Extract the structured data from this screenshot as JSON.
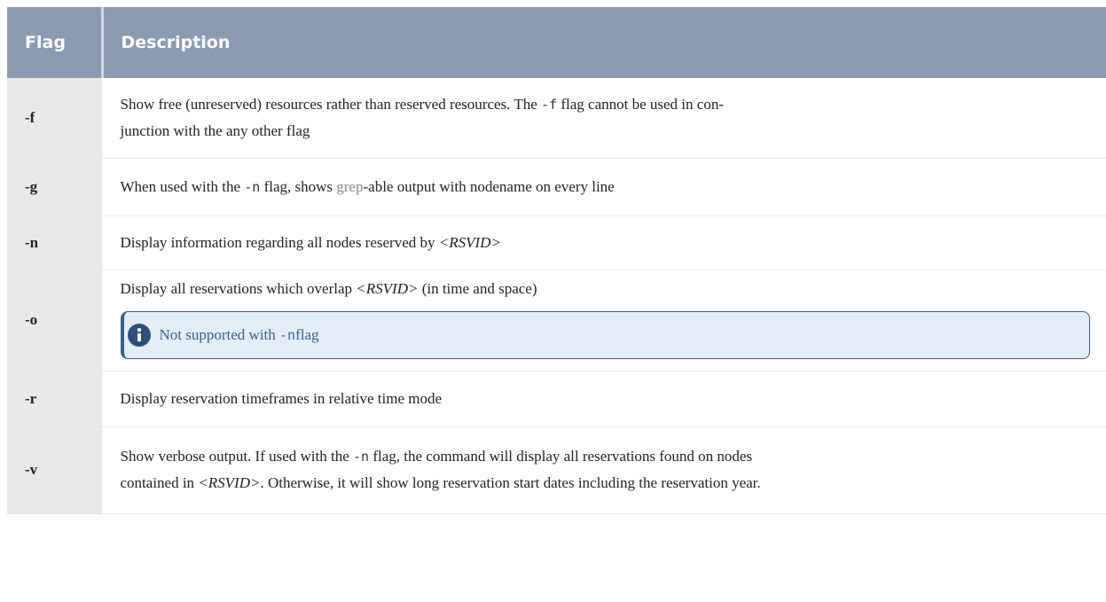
{
  "header": {
    "flag": "Flag",
    "description": "Description"
  },
  "rows": [
    {
      "flag": "-f",
      "desc_a": "Show free (unreserved) resources rather than reserved resources. The ",
      "desc_code": "-f",
      "desc_b": " flag cannot be used in con-",
      "desc_line2": "junction with the any other flag"
    },
    {
      "flag": "-g",
      "desc_a": "When used with the ",
      "desc_code": "-n",
      "desc_b": " flag, shows ",
      "desc_grep": "grep",
      "desc_c": "-able output with nodename on every line"
    },
    {
      "flag": "-n",
      "desc_a": "Display information regarding all nodes reserved by ",
      "desc_var": "<RSVID>"
    },
    {
      "flag": "-o",
      "desc_a": "Display all reservations which overlap ",
      "desc_var": "<RSVID>",
      "desc_b": " (in time and space)",
      "note_a": "Not supported with ",
      "note_code": "-n",
      "note_b": " flag"
    },
    {
      "flag": "-r",
      "desc_a": "Display reservation timeframes in relative time mode"
    },
    {
      "flag": "-v",
      "desc_a": "Show verbose output. If used with the ",
      "desc_code": "-n",
      "desc_b": " flag, the command will display all reservations found on nodes",
      "desc_c": "contained in ",
      "desc_var": "<RSVID>",
      "desc_d": ". Otherwise, it will show long reservation start dates including the reservation year."
    }
  ],
  "icons": {
    "note": "info-icon"
  },
  "colors": {
    "header_bg": "#8a9bb1",
    "flag_col_bg": "#e9e9e9",
    "note_bg": "#e3edf8",
    "note_accent": "#3c5f86"
  }
}
